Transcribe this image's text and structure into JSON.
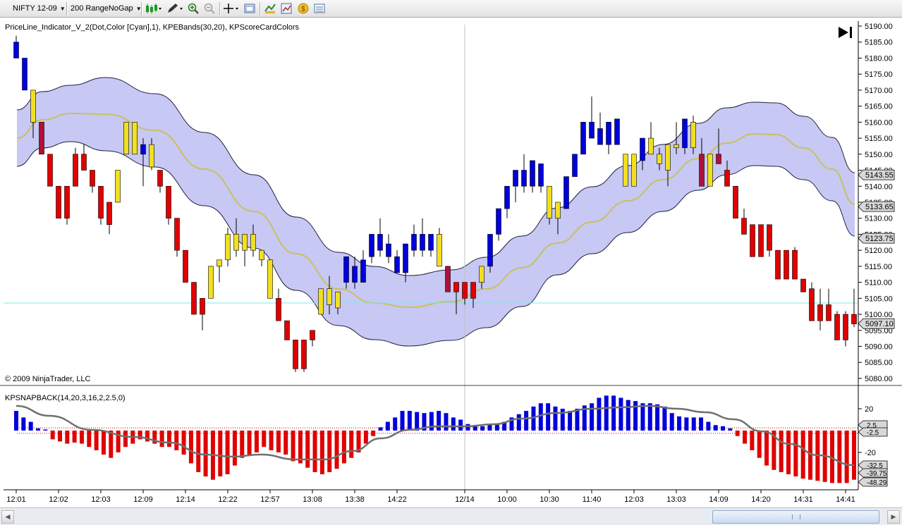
{
  "toolbar": {
    "instrument": "NIFTY 12-09",
    "bar_type": "200 RangeNoGap",
    "icons": [
      "bar-chart-style-icon",
      "pencil-draw-icon",
      "zoom-in-icon",
      "zoom-out-icon",
      "crosshair-icon",
      "properties-icon",
      "strategy-icon",
      "chart-trader-icon",
      "performance-icon",
      "data-box-icon"
    ]
  },
  "chart": {
    "indicator_label": "PriceLine_Indicator_V_2(Dot,Color [Cyan],1), KPEBands(30,20), KPScoreCardColors",
    "copyright": "© 2009 NinjaTrader, LLC",
    "price_axis": [
      "5190.00",
      "5185.00",
      "5180.00",
      "5175.00",
      "5170.00",
      "5165.00",
      "5160.00",
      "5155.00",
      "5150.00",
      "5145.00",
      "5140.00",
      "5135.00",
      "5130.00",
      "5125.00",
      "5120.00",
      "5115.00",
      "5110.00",
      "5105.00",
      "5100.00",
      "5095.00",
      "5090.00",
      "5085.00",
      "5080.00"
    ],
    "price_markers": [
      "5143.55",
      "5133.65",
      "5123.75",
      "5097.10"
    ],
    "end_icon": "skip-to-end-icon"
  },
  "oscillator": {
    "label": "KPSNAPBACK(14,20,3,16,2,2.5,0)",
    "axis": [
      "20",
      "-20"
    ],
    "markers": [
      "2.5",
      "-2.5",
      "-32.5",
      "-39.75",
      "-48.29"
    ]
  },
  "time_axis": [
    "12:01",
    "12:02",
    "12:03",
    "12:09",
    "12:14",
    "12:22",
    "12:57",
    "13:08",
    "13:38",
    "14:22",
    "12/14",
    "10:00",
    "10:30",
    "11:40",
    "12:03",
    "13:03",
    "14:09",
    "14:20",
    "14:31",
    "14:41"
  ],
  "colors": {
    "up_bar": "#0000dd",
    "down_bar": "#e00000",
    "neutral_bar": "#f0e020",
    "dark_red_bar": "#b0103a",
    "band_fill": "#c8c8f4",
    "band_mid": "#c8c060",
    "price_line": "#80e8e8",
    "osc_line": "#707070"
  }
}
